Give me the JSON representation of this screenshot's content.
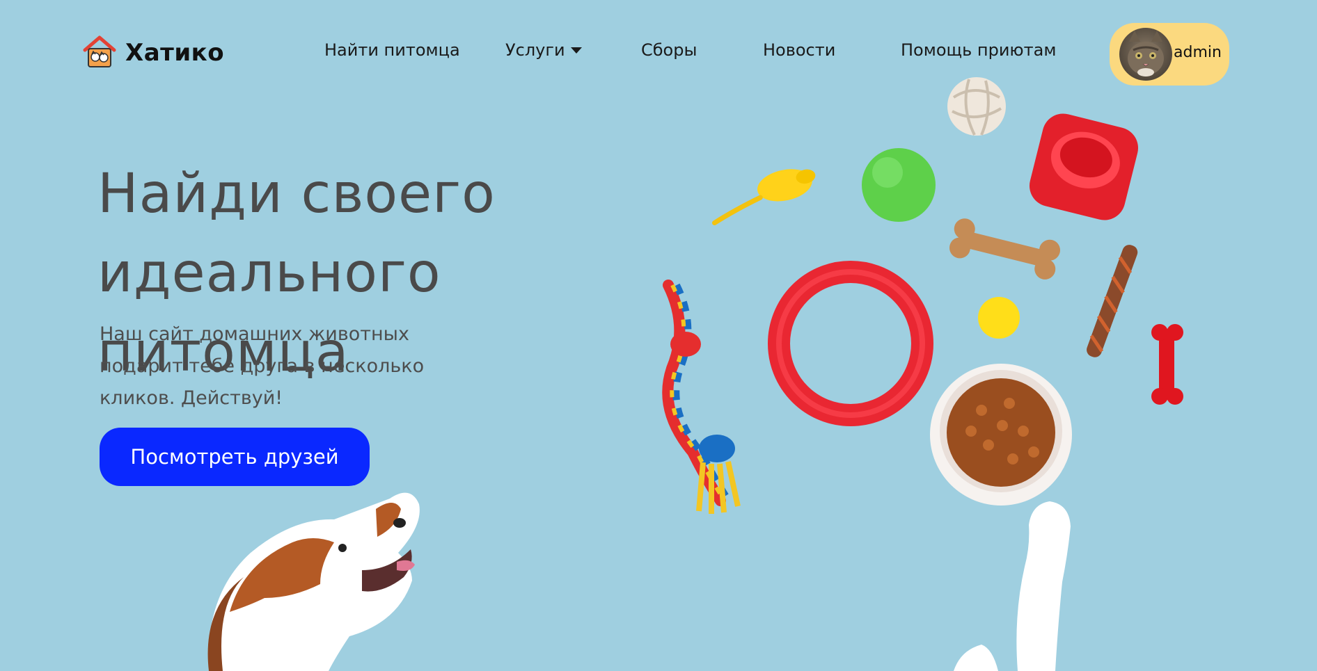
{
  "header": {
    "logo_text": "Хатико",
    "nav": [
      {
        "label": "Найти питомца"
      },
      {
        "label": "Услуги",
        "has_dropdown": true
      },
      {
        "label": "Сборы"
      },
      {
        "label": "Новости"
      },
      {
        "label": "Помощь приютам"
      }
    ],
    "user": {
      "name": "admin"
    }
  },
  "hero": {
    "title_line1": "Найди своего",
    "title_line2": "идеального питомца",
    "subtitle_line1": "Наш сайт домашних животных",
    "subtitle_line2": "подарит тебе друга в несколько",
    "subtitle_line3": "кликов. Действуй!",
    "cta_label": "Посмотреть друзей"
  },
  "colors": {
    "background": "#9fcfe0",
    "cta": "#0a28ff",
    "user_pill": "#fbd97f",
    "heading": "#4a4a4a"
  },
  "icons": {
    "logo": "house-with-cat-and-dog-icon",
    "dropdown": "caret-down-icon"
  }
}
